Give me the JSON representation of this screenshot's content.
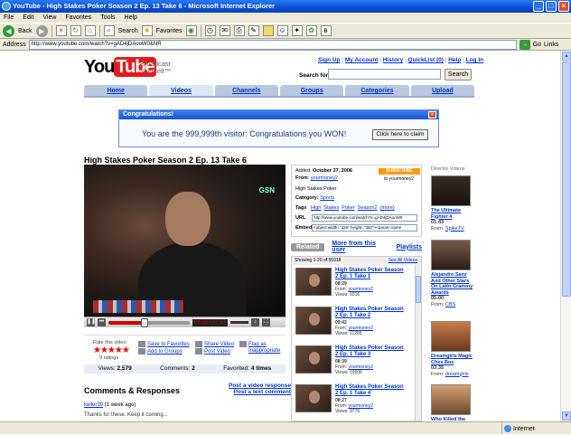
{
  "window": {
    "title": "YouTube - High Stakes Poker Season 2 Ep. 13 Take 6 - Microsoft Internet Explorer"
  },
  "menu": [
    "File",
    "Edit",
    "View",
    "Favorites",
    "Tools",
    "Help"
  ],
  "toolbar": {
    "back": "Back",
    "search": "Search",
    "favorites": "Favorites"
  },
  "address": {
    "label": "Address",
    "url": "http://www.youtube.com/watch?v=gAD4jDAooW0&NR",
    "go": "Go",
    "links": "Links"
  },
  "header": {
    "logo_you": "You",
    "logo_tube": "Tube",
    "tagline_1": "Broadcast",
    "tagline_2": "Yourself™",
    "links": [
      "Sign Up",
      "My Account",
      "History",
      "QuickList (0)",
      "Help",
      "Log In"
    ],
    "search_label": "Search for",
    "search_button": "Search"
  },
  "nav_tabs": [
    "Home",
    "Videos",
    "Channels",
    "Groups",
    "Categories",
    "Upload"
  ],
  "popup": {
    "title": "Congratulations!",
    "message": "You are the 999,999th visitor: Congratulations you WON!",
    "button": "Click here to claim"
  },
  "video": {
    "title": "High Stakes Poker Season 2 Ep. 13 Take 6",
    "overlay_logo": "GSN",
    "time_current": "03:28",
    "time_total": "07:57",
    "progress": 0.44
  },
  "rating": {
    "label": "Rate this video:",
    "stars": "★★★★★",
    "count": "9 ratings"
  },
  "actions": {
    "save_favorites": "Save to Favorites",
    "add_groups": "Add to Groups",
    "share_video": "Share Video",
    "post_video": "Post Video",
    "flag": "Flag as",
    "flag_2": "Inappropriate"
  },
  "stats": {
    "views_label": "Views:",
    "views": "2,579",
    "comments_label": "Comments:",
    "comments": "2",
    "favorited_label": "Favorited:",
    "favorited": "4 times"
  },
  "comments": {
    "heading": "Comments & Responses",
    "post_response": "Post a video response",
    "post_comment": "Post a text comment",
    "items": [
      {
        "user": "keller39",
        "when": "(1 week ago)",
        "text": "Thanks for these. Keep it coming..."
      }
    ]
  },
  "info": {
    "added_label": "Added",
    "added": "October 27, 2006",
    "from_label": "From",
    "from": "yourmoney2",
    "subscribe": "SUBSCRIBE",
    "subscribe_to": "to yourmoney2",
    "description": "High Stakes Poker",
    "category_label": "Category:",
    "category": "Sports",
    "tags_label": "Tags",
    "tags": [
      "High",
      "Stakes",
      "Poker",
      "Season2",
      "(more)"
    ],
    "url_label": "URL",
    "url_value": "http://www.youtube.com/watch?v=gAD4jDAooW0",
    "embed_label": "Embed",
    "embed_value": "<object width=\"425\" height=\"350\"><param name"
  },
  "related": {
    "tabs": [
      "Related",
      "More from this user",
      "Playlists"
    ],
    "showing": "Showing 1-20 of 56918",
    "see_all": "See All Videos",
    "items": [
      {
        "title": "High Stakes Poker Season 2 Ep. 1 Take 1",
        "duration": "08:29",
        "from": "yourmoney2",
        "views": "9316"
      },
      {
        "title": "High Stakes Poker Season 2 Ep. 1 Take 2",
        "duration": "09:42",
        "from": "yourmoney2",
        "views": "11265"
      },
      {
        "title": "High Stakes Poker Season 2 Ep. 1 Take 3",
        "duration": "08:39",
        "from": "yourmoney2",
        "views": "10006"
      },
      {
        "title": "High Stakes Poker Season 2 Ep. 1 Take 4",
        "duration": "08:27",
        "from": "yourmoney2",
        "views": "9776"
      }
    ],
    "labels": {
      "from": "From:",
      "views": "Views:"
    }
  },
  "director": {
    "heading": "Director Videos",
    "items": [
      {
        "title": "The Ultimate Fighter 4",
        "duration": "01:43",
        "from": "SpikeTV"
      },
      {
        "title": "Alejandro Sanz And Other Stars On Latin Grammy Awards",
        "duration": "05:00",
        "from": "CBS"
      },
      {
        "title": "Dreamgirls Magic Chex Box",
        "duration": "03:35",
        "from": "dreamgirls"
      },
      {
        "title": "Who Killed the",
        "duration": "",
        "from": ""
      }
    ]
  },
  "status": {
    "zone": "Internet"
  }
}
